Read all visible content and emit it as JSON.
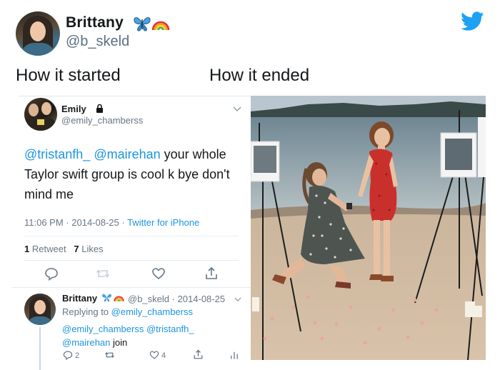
{
  "outer_tweet": {
    "name": "Brittany",
    "handle": "@b_skeld",
    "name_emojis": [
      "butterfly-icon",
      "rainbow-icon"
    ],
    "captions": {
      "left": "How it started",
      "right": "How it ended"
    }
  },
  "inner_tweet": {
    "name": "Emily",
    "handle": "@emily_chamberss",
    "mentions": "@tristanfh_ @mairehan",
    "text_line1_rest": " your whole",
    "text_line2": "Taylor swift group is cool k bye don't",
    "text_line3": "mind me",
    "time": "11:06 PM",
    "date": "2014-08-25",
    "source": "Twitter for iPhone",
    "retweets_count": "1",
    "retweets_label": "Retweet",
    "likes_count": "7",
    "likes_label": "Likes"
  },
  "reply": {
    "name": "Brittany",
    "handle": "@b_skeld",
    "date": "2014-08-25",
    "replying_prefix": "Replying to",
    "replying_to": "@emily_chamberss",
    "mentions_line": "@emily_chamberss @tristanfh_",
    "last_mention": "@mairehan",
    "last_word": " join",
    "reply_count": "2",
    "like_count": "4"
  },
  "colors": {
    "twitter_blue": "#1da1f2",
    "link": "#1b95e0",
    "muted": "#657786"
  }
}
